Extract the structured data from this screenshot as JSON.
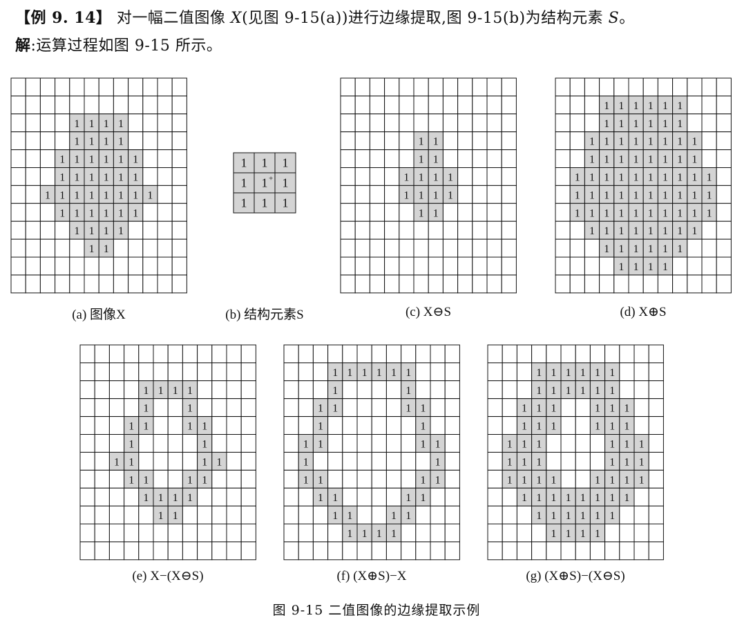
{
  "example": {
    "tag": "【例 9. 14】",
    "text1": " 对一幅二值图像 ",
    "var_x": "X",
    "text2": "(见图 9-15(a))进行边缘提取,图 9-15(b)为结构元素 ",
    "var_s": "S",
    "text3": "。"
  },
  "solution": {
    "label": "解",
    "text": ":运算过程如图 9-15 所示。"
  },
  "panels": [
    {
      "id": "a",
      "caption": "(a) 图像X",
      "cells": [
        "000000000000",
        "000000000000",
        "000011110000",
        "000011110000",
        "000111111000",
        "000111111000",
        "001111111100",
        "000111111000",
        "000011110000",
        "000001100000",
        "000000000000",
        "000000000000"
      ]
    },
    {
      "id": "b",
      "caption": "(b) 结构元素S",
      "origin_mark": "+",
      "cells": [
        "111",
        "111",
        "111"
      ]
    },
    {
      "id": "c",
      "caption": "(c) X⊖S",
      "cells": [
        "000000000000",
        "000000000000",
        "000000000000",
        "000001100000",
        "000001100000",
        "000011110000",
        "000011110000",
        "000001100000",
        "000000000000",
        "000000000000",
        "000000000000",
        "000000000000"
      ]
    },
    {
      "id": "d",
      "caption": "(d) X⊕S",
      "cells": [
        "000000000000",
        "000111111000",
        "000111111000",
        "001111111100",
        "001111111100",
        "011111111110",
        "011111111110",
        "011111111110",
        "001111111100",
        "000111111000",
        "000011110000",
        "000000000000"
      ]
    },
    {
      "id": "e",
      "caption": "(e) X−(X⊖S)",
      "cells": [
        "000000000000",
        "000000000000",
        "000011110000",
        "000010010000",
        "000110011000",
        "000100001000",
        "001100001100",
        "000110011000",
        "000011110000",
        "000001100000",
        "000000000000",
        "000000000000"
      ]
    },
    {
      "id": "f",
      "caption": "(f) (X⊕S)−X",
      "cells": [
        "000000000000",
        "000111111000",
        "000100001000",
        "001100001100",
        "001000000100",
        "011000000110",
        "010000000010",
        "011000000110",
        "001100001100",
        "000110011000",
        "000011110000",
        "000000000000"
      ]
    },
    {
      "id": "g",
      "caption": "(g) (X⊕S)−(X⊖S)",
      "cells": [
        "000000000000",
        "000111111000",
        "000111111000",
        "001110011100",
        "001110011100",
        "011100001110",
        "011100001110",
        "011110011110",
        "001111111100",
        "000111111000",
        "000011110000",
        "000000000000"
      ]
    }
  ],
  "cell_value": "1",
  "colors": {
    "filled": "#d4d4d4",
    "line": "#111111",
    "empty": "#ffffff"
  },
  "figure_caption": "图 9-15   二值图像的边缘提取示例"
}
